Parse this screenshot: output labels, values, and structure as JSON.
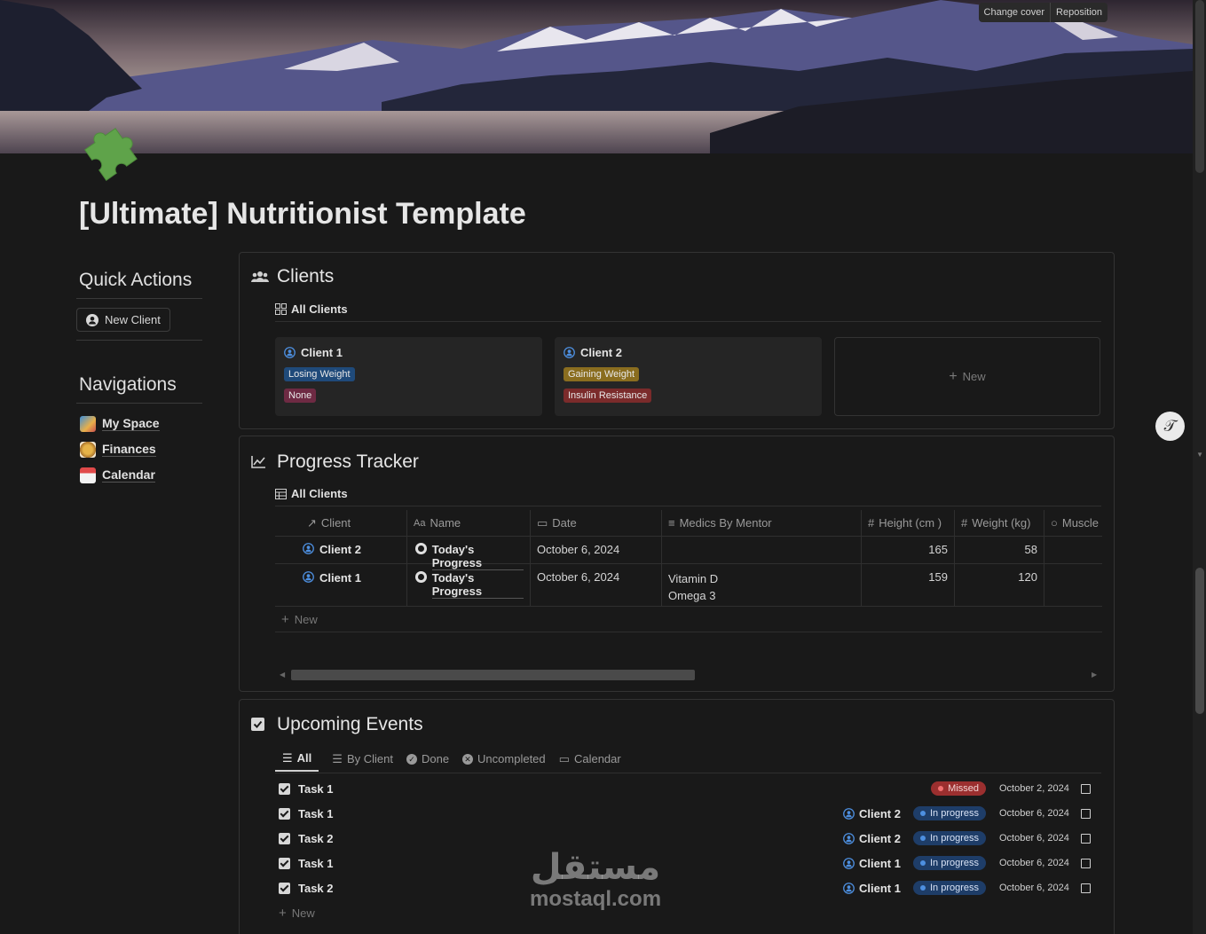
{
  "cover": {
    "change_cover": "Change cover",
    "reposition": "Reposition"
  },
  "page": {
    "icon": "puzzle-piece-icon",
    "title": "[Ultimate] Nutritionist Template"
  },
  "quick_actions": {
    "heading": "Quick Actions",
    "new_client": "New Client"
  },
  "navigations": {
    "heading": "Navigations",
    "items": [
      {
        "label": "My Space",
        "icon": "map-icon"
      },
      {
        "label": "Finances",
        "icon": "coin-icon"
      },
      {
        "label": "Calendar",
        "icon": "calendar-icon"
      }
    ]
  },
  "clients": {
    "title": "Clients",
    "view": "All Clients",
    "cards": [
      {
        "name": "Client 1",
        "tags": [
          "Losing Weight",
          "None"
        ]
      },
      {
        "name": "Client 2",
        "tags": [
          "Gaining Weight",
          "Insulin Resistance"
        ]
      }
    ],
    "new_label": "New"
  },
  "progress": {
    "title": "Progress Tracker",
    "view": "All Clients",
    "headers": [
      "Client",
      "Name",
      "Date",
      "Medics By Mentor",
      "Height (cm )",
      "Weight (kg)",
      "Muscle"
    ],
    "rows": [
      {
        "client": "Client 2",
        "name": "Today's Progress",
        "date": "October 6, 2024",
        "medics1": "",
        "medics2": "",
        "height": "165",
        "weight": "58"
      },
      {
        "client": "Client 1",
        "name": "Today's Progress",
        "date": "October 6, 2024",
        "medics1": "Vitamin D",
        "medics2": "Omega 3",
        "height": "159",
        "weight": "120"
      }
    ],
    "new_label": "New"
  },
  "events": {
    "title": "Upcoming Events",
    "tabs": [
      "All",
      "By Client",
      "Done",
      "Uncompleted",
      "Calendar"
    ],
    "rows": [
      {
        "name": "Task 1",
        "client": "",
        "status": "Missed",
        "date": "October 2, 2024"
      },
      {
        "name": "Task 1",
        "client": "Client 2",
        "status": "In progress",
        "date": "October 6, 2024"
      },
      {
        "name": "Task 2",
        "client": "Client 2",
        "status": "In progress",
        "date": "October 6, 2024"
      },
      {
        "name": "Task 1",
        "client": "Client 1",
        "status": "In progress",
        "date": "October 6, 2024"
      },
      {
        "name": "Task 2",
        "client": "Client 1",
        "status": "In progress",
        "date": "October 6, 2024"
      }
    ],
    "new_label": "New"
  },
  "watermark": {
    "arabic": "مستقل",
    "latin": "mostaql.com"
  },
  "colors": {
    "tag_losing": "#1f4a7a",
    "tag_none": "#6e2a43",
    "tag_gaining": "#8a6d1f",
    "tag_insulin": "#7b2b2b",
    "missed": "#9b2f2f",
    "in_progress": "#1e3d68",
    "puzzle": "#5fa34a"
  }
}
